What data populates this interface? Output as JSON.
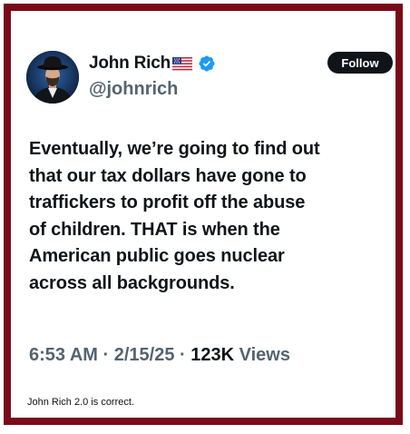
{
  "author": {
    "name": "John Rich",
    "handle": "@johnrich",
    "flag_icon": "us-flag-icon",
    "verified_icon": "verified-badge-icon"
  },
  "follow_button": {
    "label": "Follow"
  },
  "tweet": {
    "lines": [
      "Eventually, we’re going to find out",
      "that our tax dollars have gone to",
      "traffickers to profit off the abuse",
      "of children. THAT is when the",
      "American public goes nuclear",
      "across all backgrounds."
    ],
    "time": "6:53 AM",
    "date": "2/15/25",
    "views_count": "123K",
    "views_label": "Views",
    "separator": "·"
  },
  "caption": "John Rich 2.0 is correct.",
  "colors": {
    "frame": "#7a0a1a",
    "text_primary": "#0f1419",
    "text_secondary": "#536471",
    "verified": "#1d9bf0",
    "follow_bg": "#0f1419"
  }
}
